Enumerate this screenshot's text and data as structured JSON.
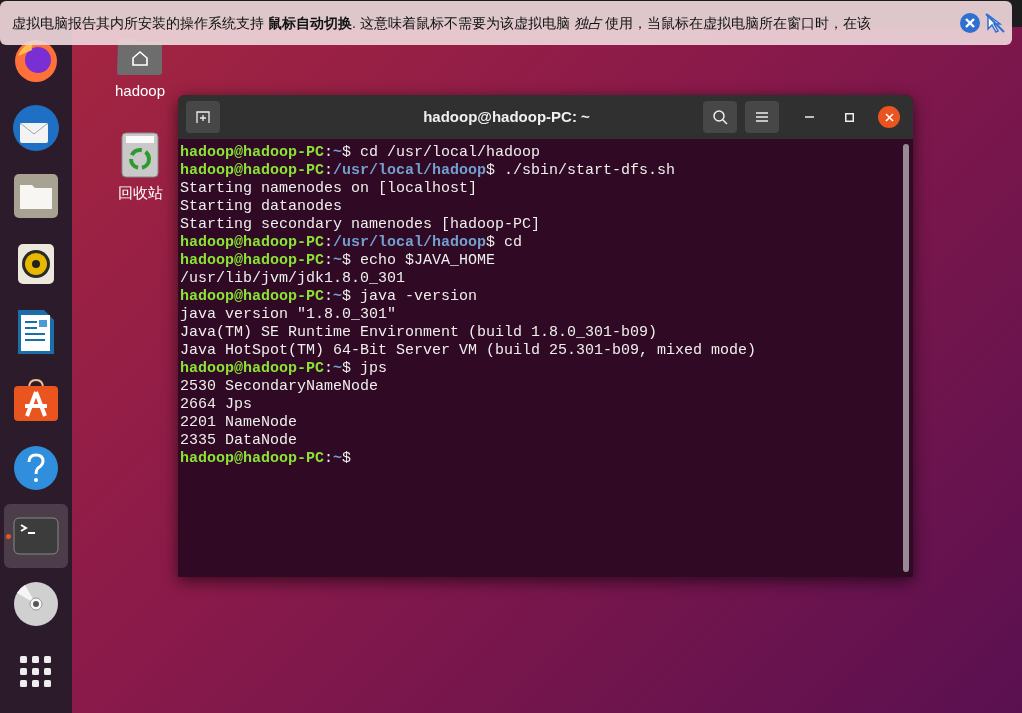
{
  "notification": {
    "message": "虚拟电脑报告其内所安装的操作系统支持 **鼠标自动切换**. 这意味着鼠标不需要为该虚拟电脑 *独占* 使用，当鼠标在虚拟电脑所在窗口时，在该"
  },
  "dock": {
    "items": [
      {
        "kind": "firefox",
        "selected": false,
        "running": false
      },
      {
        "kind": "mail",
        "selected": false,
        "running": false
      },
      {
        "kind": "files",
        "selected": false,
        "running": false
      },
      {
        "kind": "speaker",
        "selected": false,
        "running": false
      },
      {
        "kind": "writer",
        "selected": false,
        "running": false
      },
      {
        "kind": "store",
        "selected": false,
        "running": false
      },
      {
        "kind": "help",
        "selected": false,
        "running": false
      },
      {
        "kind": "terminal",
        "selected": true,
        "running": true
      },
      {
        "kind": "disc",
        "selected": false,
        "running": false
      },
      {
        "kind": "apps",
        "selected": false,
        "running": false
      }
    ]
  },
  "desktop_icons": [
    {
      "kind": "home",
      "label": "hadoop"
    },
    {
      "kind": "trash",
      "label": "回收站"
    }
  ],
  "terminal": {
    "title": "hadoop@hadoop-PC: ~",
    "lines": [
      [
        {
          "kind": "user",
          "text": "hadoop@hadoop-PC"
        },
        {
          "kind": "plain",
          "text": ":"
        },
        {
          "kind": "path",
          "text": "~"
        },
        {
          "kind": "plain",
          "text": "$ cd /usr/local/hadoop"
        }
      ],
      [
        {
          "kind": "user",
          "text": "hadoop@hadoop-PC"
        },
        {
          "kind": "plain",
          "text": ":"
        },
        {
          "kind": "path",
          "text": "/usr/local/hadoop"
        },
        {
          "kind": "plain",
          "text": "$ ./sbin/start-dfs.sh"
        }
      ],
      [
        {
          "kind": "plain",
          "text": "Starting namenodes on [localhost]"
        }
      ],
      [
        {
          "kind": "plain",
          "text": "Starting datanodes"
        }
      ],
      [
        {
          "kind": "plain",
          "text": "Starting secondary namenodes [hadoop-PC]"
        }
      ],
      [
        {
          "kind": "user",
          "text": "hadoop@hadoop-PC"
        },
        {
          "kind": "plain",
          "text": ":"
        },
        {
          "kind": "path",
          "text": "/usr/local/hadoop"
        },
        {
          "kind": "plain",
          "text": "$ cd"
        }
      ],
      [
        {
          "kind": "user",
          "text": "hadoop@hadoop-PC"
        },
        {
          "kind": "plain",
          "text": ":"
        },
        {
          "kind": "path",
          "text": "~"
        },
        {
          "kind": "plain",
          "text": "$ echo $JAVA_HOME"
        }
      ],
      [
        {
          "kind": "plain",
          "text": "/usr/lib/jvm/jdk1.8.0_301"
        }
      ],
      [
        {
          "kind": "user",
          "text": "hadoop@hadoop-PC"
        },
        {
          "kind": "plain",
          "text": ":"
        },
        {
          "kind": "path",
          "text": "~"
        },
        {
          "kind": "plain",
          "text": "$ java -version"
        }
      ],
      [
        {
          "kind": "plain",
          "text": "java version \"1.8.0_301\""
        }
      ],
      [
        {
          "kind": "plain",
          "text": "Java(TM) SE Runtime Environment (build 1.8.0_301-b09)"
        }
      ],
      [
        {
          "kind": "plain",
          "text": "Java HotSpot(TM) 64-Bit Server VM (build 25.301-b09, mixed mode)"
        }
      ],
      [
        {
          "kind": "user",
          "text": "hadoop@hadoop-PC"
        },
        {
          "kind": "plain",
          "text": ":"
        },
        {
          "kind": "path",
          "text": "~"
        },
        {
          "kind": "plain",
          "text": "$ jps"
        }
      ],
      [
        {
          "kind": "plain",
          "text": "2530 SecondaryNameNode"
        }
      ],
      [
        {
          "kind": "plain",
          "text": "2664 Jps"
        }
      ],
      [
        {
          "kind": "plain",
          "text": "2201 NameNode"
        }
      ],
      [
        {
          "kind": "plain",
          "text": "2335 DataNode"
        }
      ],
      [
        {
          "kind": "user",
          "text": "hadoop@hadoop-PC"
        },
        {
          "kind": "plain",
          "text": ":"
        },
        {
          "kind": "path",
          "text": "~"
        },
        {
          "kind": "plain",
          "text": "$"
        }
      ]
    ]
  }
}
